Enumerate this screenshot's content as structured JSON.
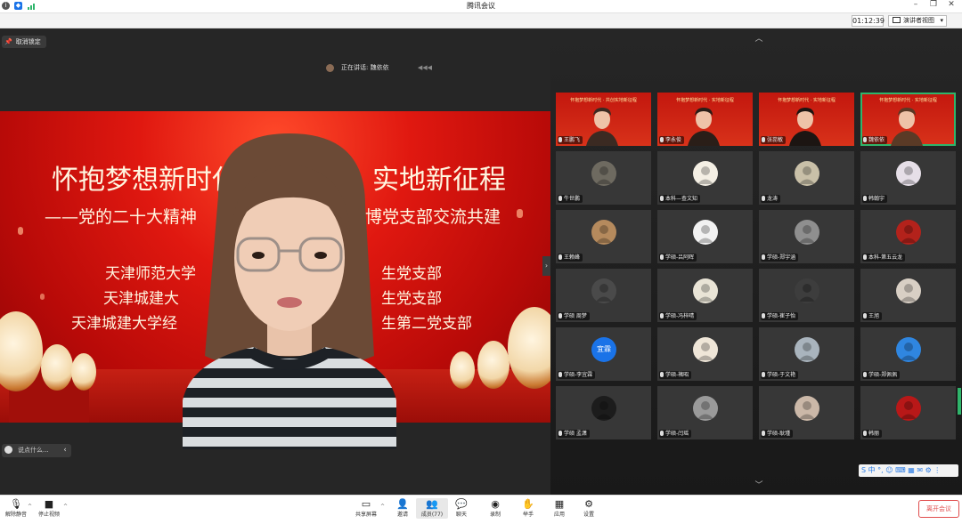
{
  "window": {
    "title": "腾讯会议"
  },
  "infobar": {
    "timer": "01:12:39",
    "view_button": "演讲者视图"
  },
  "stage": {
    "unpin_label": "取消锁定",
    "speaking_label": "正在讲话: 魏依依",
    "chat_placeholder": "说点什么...",
    "slide": {
      "line1": "怀抱梦想新时代",
      "line1b": "实地新征程",
      "line2": "——党的二十大精神",
      "line2b": "博党支部交流共建",
      "line3": "天津师范大学",
      "line3b": "生党支部",
      "line4": "天津城建大",
      "line4b": "生党支部",
      "line5": "天津城建大学经",
      "line5b": "生第二党支部"
    }
  },
  "gallery": {
    "participants": [
      {
        "name": "王鹏飞",
        "type": "video",
        "banner": "怀抱梦想新时代 · 共创实地新征程",
        "color": "#3b2a22"
      },
      {
        "name": "李永俊",
        "type": "video",
        "banner": "怀抱梦想新时代 · 实地新征程",
        "color": "#2a1e18"
      },
      {
        "name": "张蕊敏",
        "type": "video",
        "banner": "怀抱梦想新时代 · 实地新征程",
        "color": "#1c1512"
      },
      {
        "name": "魏依依",
        "type": "video",
        "banner": "怀抱梦想新时代 · 实地新征程",
        "color": "#5a3a26",
        "active": true
      },
      {
        "name": "牛世鹏",
        "type": "avatar",
        "color": "#6e6a60"
      },
      {
        "name": "本科—查文知",
        "type": "avatar",
        "color": "#f4efe4"
      },
      {
        "name": "龙涛",
        "type": "avatar",
        "color": "#c9c0a8"
      },
      {
        "name": "韩翰宇",
        "type": "avatar",
        "color": "#e6dfe8"
      },
      {
        "name": "王赖峰",
        "type": "avatar",
        "color": "#b58a5d"
      },
      {
        "name": "学硕-吕阿晖",
        "type": "avatar",
        "color": "#f2f2f2"
      },
      {
        "name": "学硕-郑宇涵",
        "type": "avatar",
        "color": "#8f8f8f"
      },
      {
        "name": "本科-第五云龙",
        "type": "avatar",
        "color": "#b3221b"
      },
      {
        "name": "学硕 周梦",
        "type": "avatar",
        "color": "#4a4a4a"
      },
      {
        "name": "学硕-冯梓晴",
        "type": "avatar",
        "color": "#e9e4d6"
      },
      {
        "name": "学硕-崔子怡",
        "type": "avatar",
        "color": "#3d3d3d"
      },
      {
        "name": "王旭",
        "type": "avatar",
        "color": "#d8cfc4"
      },
      {
        "name": "学硕-李宜霖",
        "type": "initials",
        "initials": "宜霖",
        "color": "#1a73e8"
      },
      {
        "name": "学硕-褚昭",
        "type": "avatar",
        "color": "#efe6d8"
      },
      {
        "name": "学硕-于文艳",
        "type": "avatar",
        "color": "#a9b4bd"
      },
      {
        "name": "学硕-郑佩佩",
        "type": "avatar",
        "color": "#2f86e0"
      },
      {
        "name": "学硕 孟潇",
        "type": "avatar",
        "color": "#1c1c1c"
      },
      {
        "name": "学硕-闫瑶",
        "type": "avatar",
        "color": "#9a9a9a"
      },
      {
        "name": "学硕-耿瑾",
        "type": "avatar",
        "color": "#cbb8a8"
      },
      {
        "name": "韩丽",
        "type": "avatar",
        "color": "#b81818"
      }
    ]
  },
  "ime": {
    "label": "S 中 °, ☺ ⌨ ▦ ✉ ⚙ ⋮"
  },
  "toolbar": {
    "mute": "解除静音",
    "video": "停止视频",
    "share": "共享屏幕",
    "invite": "邀请",
    "members": "成员(77)",
    "chat": "聊天",
    "record": "录制",
    "raise_hand": "举手",
    "apps": "应用",
    "settings": "设置",
    "end_meeting": "离开会议"
  },
  "colors": {
    "accent": "#1a73e8",
    "danger": "#e04c4c",
    "active": "#2fb56b"
  }
}
